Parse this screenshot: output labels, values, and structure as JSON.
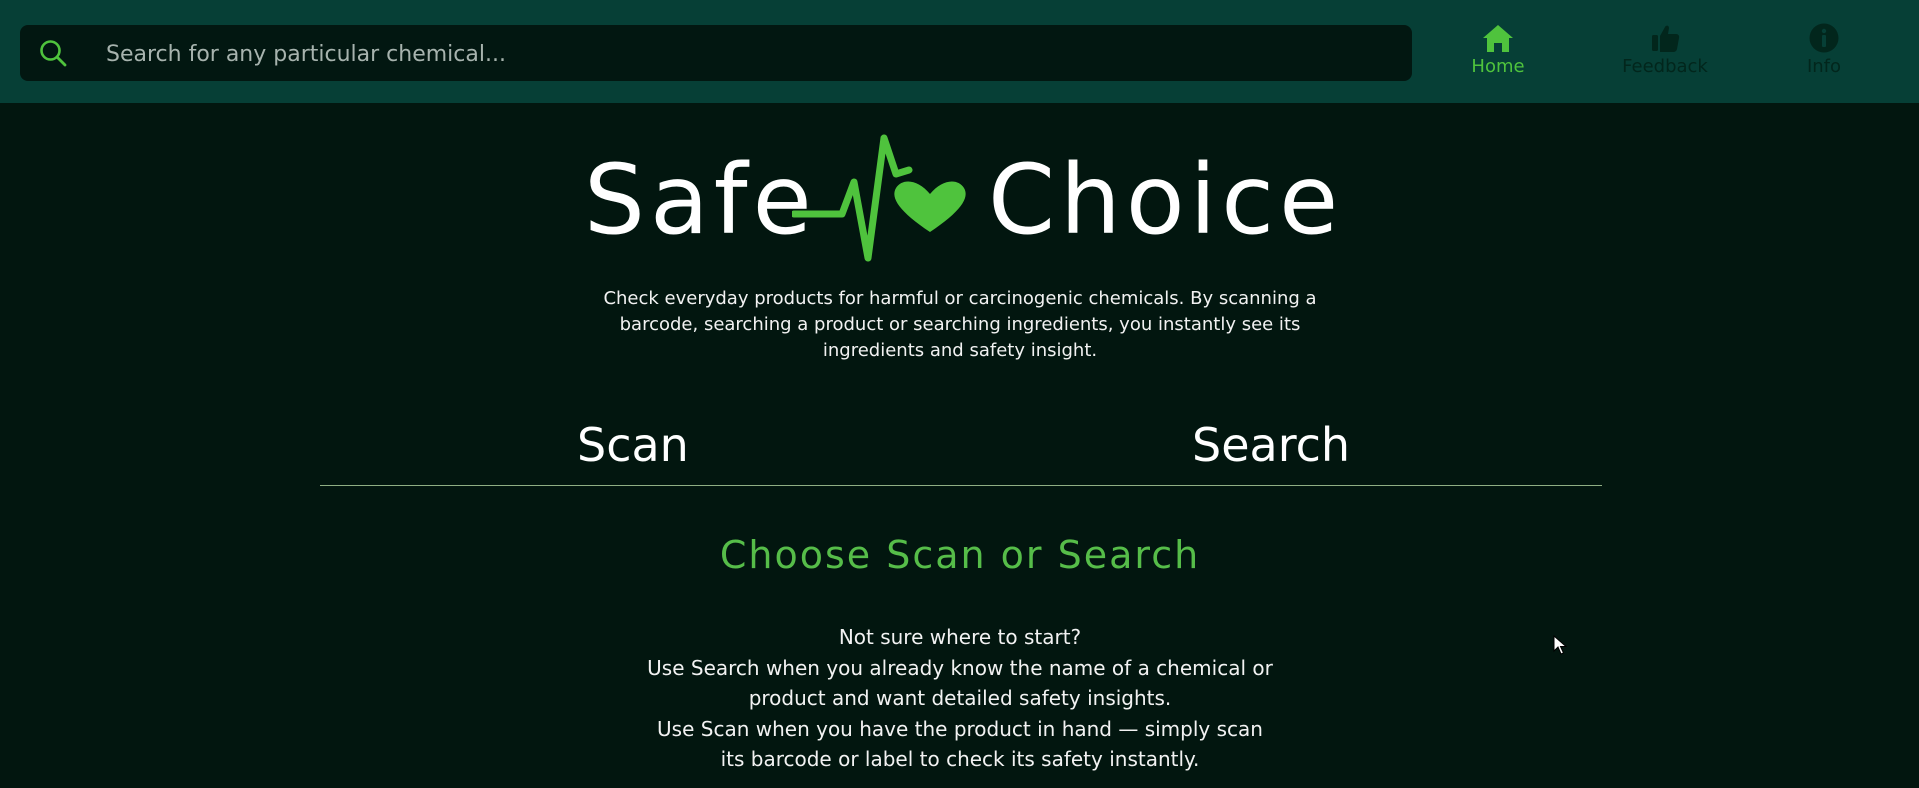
{
  "header": {
    "search": {
      "placeholder": "Search for any particular chemical...",
      "icon": "search-icon"
    },
    "nav": [
      {
        "label": "Home",
        "icon": "home-icon",
        "active": true
      },
      {
        "label": "Feedback",
        "icon": "thumbs-up-icon",
        "active": false
      },
      {
        "label": "Info",
        "icon": "info-icon",
        "active": false
      }
    ]
  },
  "logo": {
    "left": "Safe",
    "right": "Choice",
    "graphic": "heartbeat-heart-icon"
  },
  "tagline": "Check everyday products for harmful or carcinogenic chemicals. By scanning a barcode, searching a product or searching ingredients, you instantly see its ingredients and safety insight.",
  "tabs": {
    "scan": "Scan",
    "search": "Search"
  },
  "main": {
    "heading": "Choose Scan or Search",
    "guidance": [
      "Not sure where to start?",
      "Use Search when you already know the name of a chemical or",
      "product and want detailed safety insights.",
      "Use Scan when you have the product in hand — simply scan",
      "its barcode or label to check its safety instantly."
    ]
  },
  "colors": {
    "background": "#02160f",
    "topbar": "#063f36",
    "search_bg": "#021711",
    "accent_green": "#4fc33d",
    "inactive_nav": "#02261c",
    "text": "#ffffff"
  }
}
